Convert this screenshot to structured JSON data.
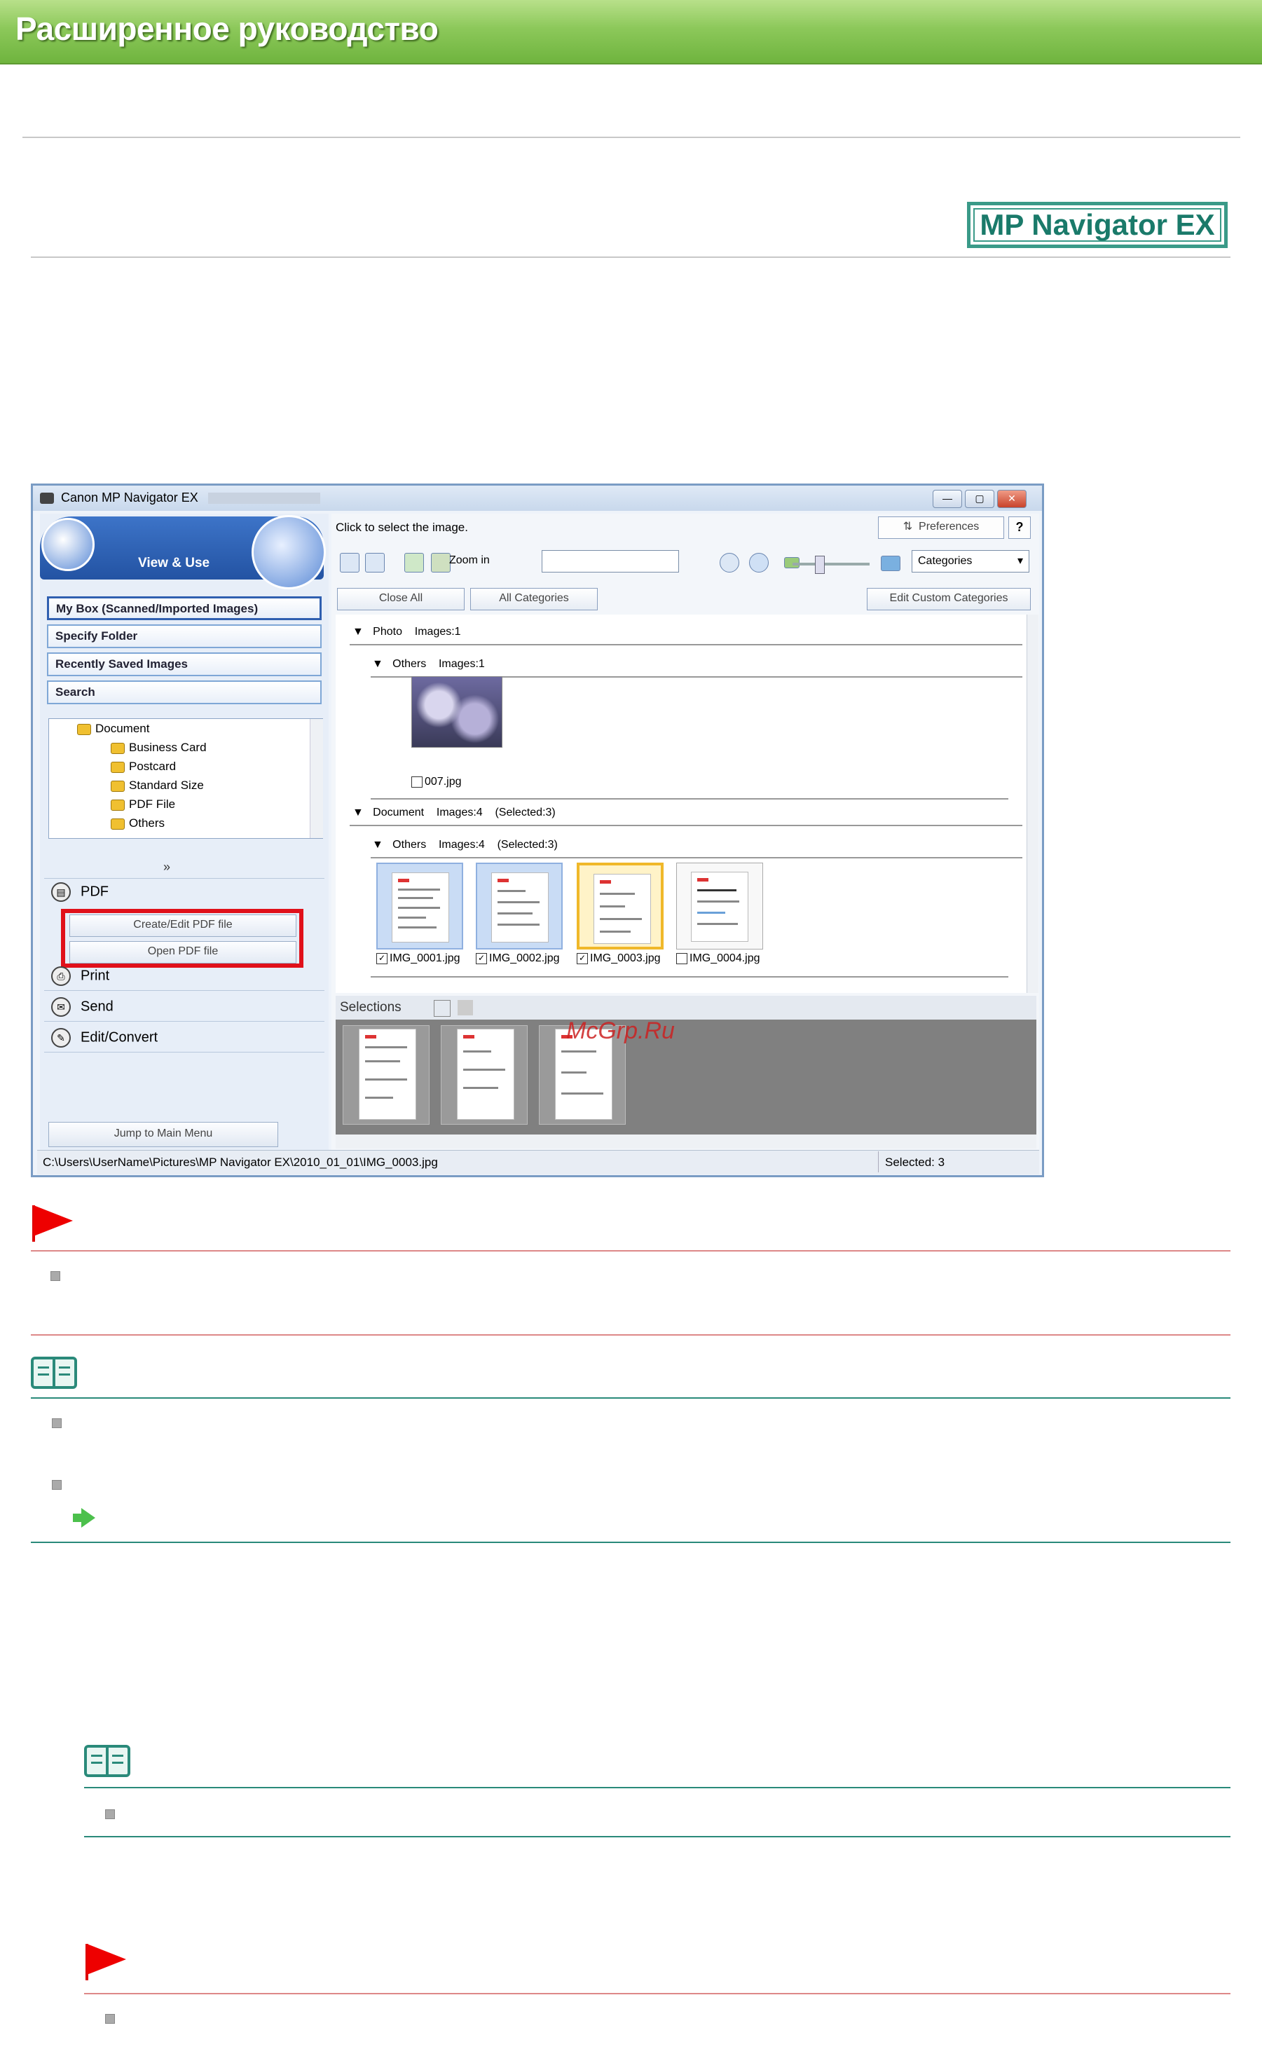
{
  "header": {
    "title": "Расширенное руководство"
  },
  "logo": {
    "text": "MP Navigator EX"
  },
  "app": {
    "window_title": "Canon MP Navigator EX",
    "view_label": "View & Use",
    "nav": {
      "my_box": "My Box (Scanned/Imported Images)",
      "specify_folder": "Specify Folder",
      "recently_saved": "Recently Saved Images",
      "search": "Search"
    },
    "tree": [
      "Document",
      "Business Card",
      "Postcard",
      "Standard Size",
      "PDF File",
      "Others"
    ],
    "tasks": {
      "pdf": "PDF",
      "create_edit_pdf": "Create/Edit PDF file",
      "open_pdf": "Open PDF file",
      "print": "Print",
      "send": "Send",
      "edit_convert": "Edit/Convert"
    },
    "jump_main_menu": "Jump to Main Menu",
    "click_to_select": "Click to select the image.",
    "preferences": "Preferences",
    "help": "?",
    "zoom_in": "Zoom in",
    "categories_select": "Categories",
    "close_all": "Close All",
    "all_categories": "All Categories",
    "edit_custom_categories": "Edit Custom Categories",
    "groups": {
      "photo": {
        "label": "Photo",
        "count": "Images:1"
      },
      "photo_others": {
        "label": "Others",
        "count": "Images:1"
      },
      "document": {
        "label": "Document",
        "count": "Images:4",
        "selected": "(Selected:3)"
      },
      "document_others": {
        "label": "Others",
        "count": "Images:4",
        "selected": "(Selected:3)"
      }
    },
    "photo_file": "007.jpg",
    "doc_files": [
      "IMG_0001.jpg",
      "IMG_0002.jpg",
      "IMG_0003.jpg",
      "IMG_0004.jpg"
    ],
    "selections_label": "Selections",
    "status_path": "C:\\Users\\UserName\\Pictures\\MP Navigator EX\\2010_01_01\\IMG_0003.jpg",
    "status_selected": "Selected: 3"
  },
  "watermark": "McGrp.Ru",
  "colors": {
    "banner": "#8cc85a",
    "highlight": "#e0101a",
    "note": "#2a8a7a",
    "important": "#e00000"
  }
}
